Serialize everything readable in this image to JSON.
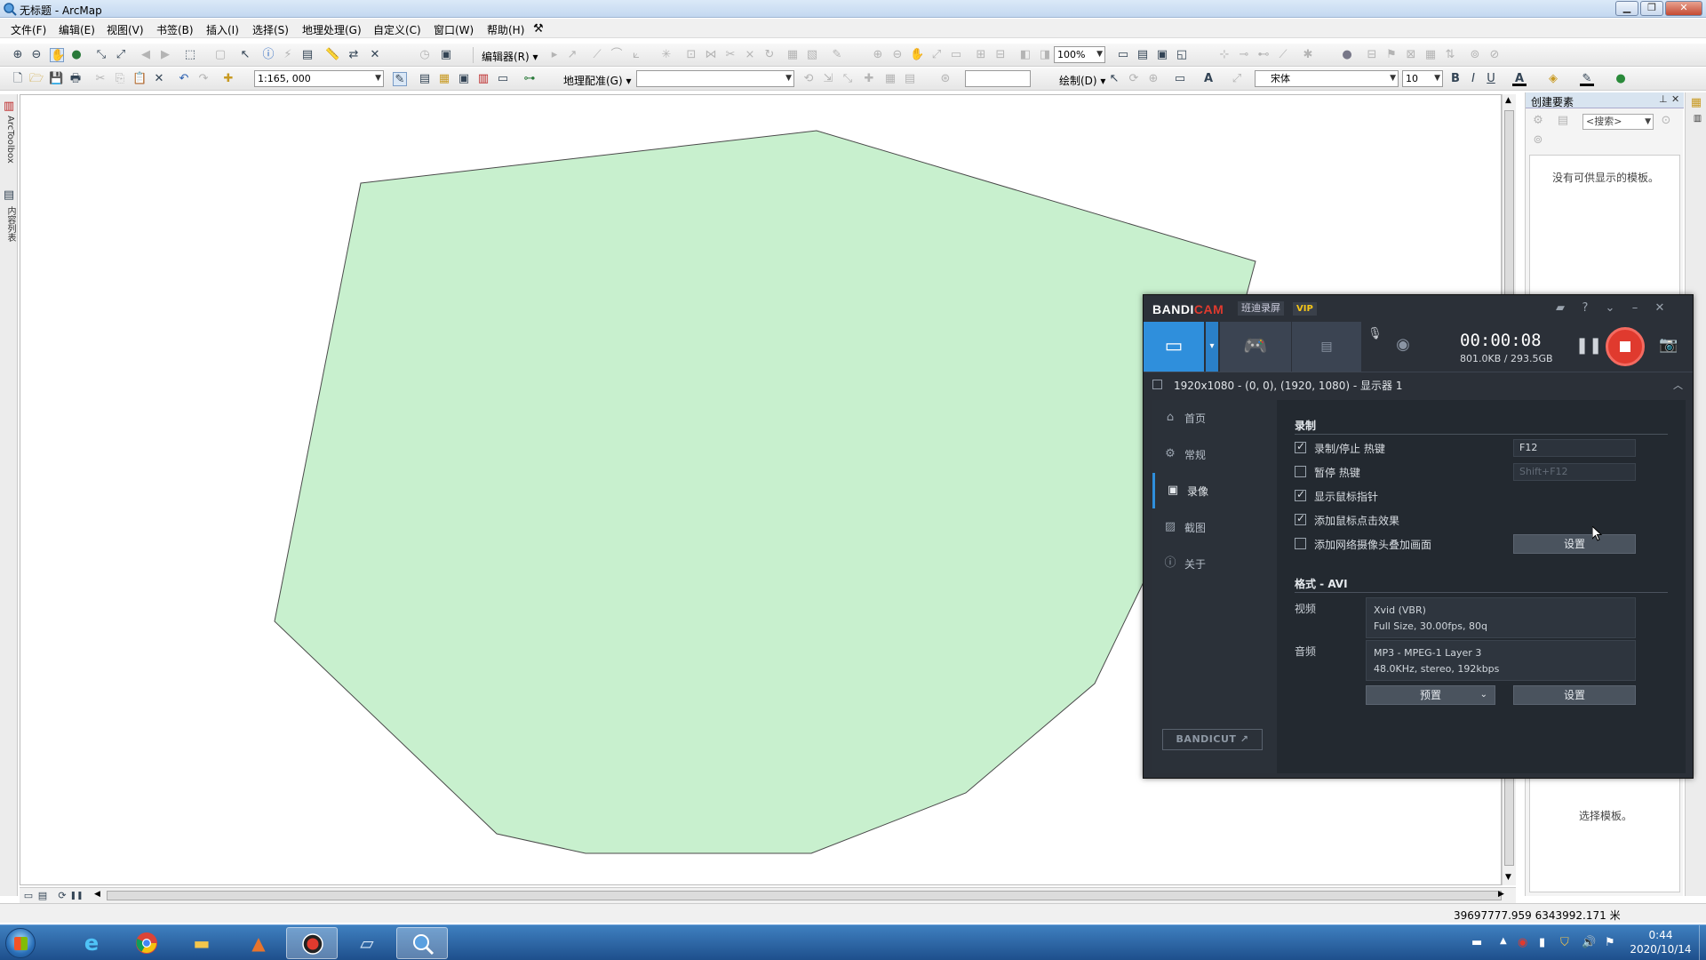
{
  "window": {
    "title": "无标题 - ArcMap"
  },
  "menu": [
    "文件(F)",
    "编辑(E)",
    "视图(V)",
    "书签(B)",
    "插入(I)",
    "选择(S)",
    "地理处理(G)",
    "自定义(C)",
    "窗口(W)",
    "帮助(H)"
  ],
  "toolbar1": {
    "editor_label": "编辑器(R) ▾",
    "zoom_value": "100%"
  },
  "toolbar2": {
    "scale_value": "1:165, 000",
    "georef_label": "地理配准(G) ▾",
    "draw_label": "绘制(D) ▾",
    "font_name": "宋体",
    "font_size": "10"
  },
  "left_dock": {
    "arctoolbox": "ArcToolbox",
    "toc": "内容列表"
  },
  "map": {
    "polygon_fill": "#c8f0ce",
    "polygon_stroke": "#4a4a4a"
  },
  "create_features": {
    "title": "创建要素",
    "search_placeholder": "<搜索>",
    "no_templates": "没有可供显示的模板。",
    "select_template": "选择模板。"
  },
  "status_bar": {
    "coords": "39697777.959  6343992.171 米"
  },
  "bandicam": {
    "logo_a": "BANDI",
    "logo_b": "CAM",
    "subtitle": "班迪录屏",
    "vip": "VIP",
    "timer": "00:00:08",
    "file_size": "801.0KB / 293.5GB",
    "region": "1920x1080 - (0, 0), (1920, 1080) - 显示器 1",
    "nav": [
      "首页",
      "常规",
      "录像",
      "截图",
      "关于"
    ],
    "record_section": "录制",
    "options": [
      {
        "label": "录制/停止 热键",
        "checked": true
      },
      {
        "label": "暂停 热键",
        "checked": false
      },
      {
        "label": "显示鼠标指针",
        "checked": true
      },
      {
        "label": "添加鼠标点击效果",
        "checked": true
      },
      {
        "label": "添加网络摄像头叠加画面",
        "checked": false
      }
    ],
    "hotkey_record": "F12",
    "hotkey_pause": "Shift+F12",
    "settings_btn": "设置",
    "format_section": "格式 - AVI",
    "video_label": "视频",
    "video_line1": "Xvid (VBR)",
    "video_line2": "Full Size, 30.00fps, 80q",
    "audio_label": "音频",
    "audio_line1": "MP3 - MPEG-1 Layer 3",
    "audio_line2": "48.0KHz, stereo, 192kbps",
    "preset_btn": "预置",
    "bandicut": "BANDICUT ↗"
  },
  "taskbar": {
    "time": "0:44",
    "date": "2020/10/14"
  }
}
